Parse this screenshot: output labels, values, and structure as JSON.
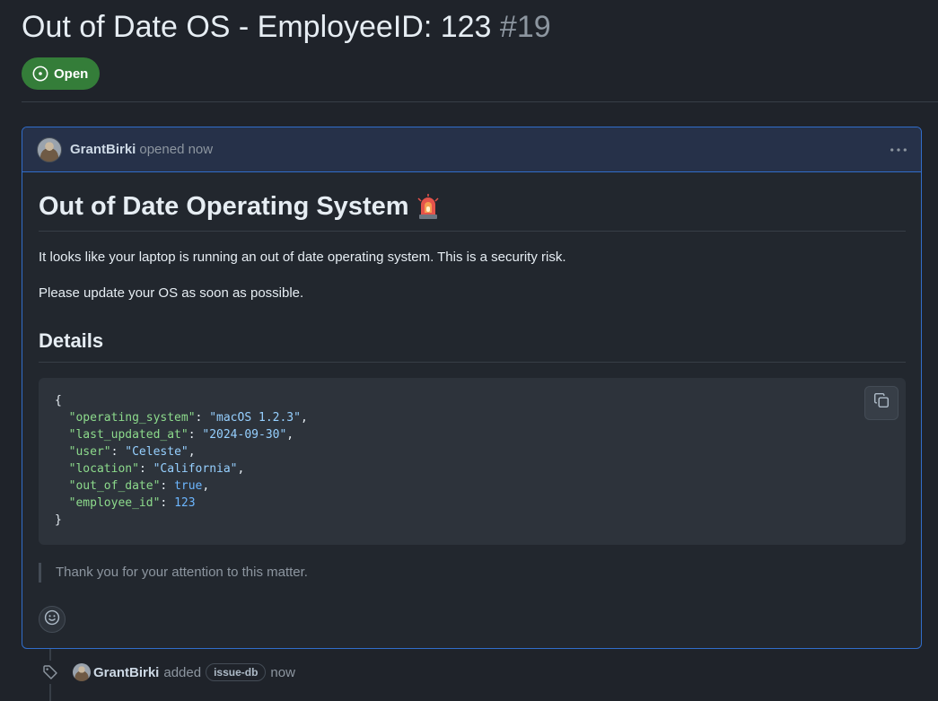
{
  "issue": {
    "title": "Out of Date OS - EmployeeID: 123",
    "number": "#19",
    "state": "Open",
    "state_color": "#347d39"
  },
  "comment": {
    "author": "GrantBirki",
    "opened_text": "opened now",
    "menu_icon": "kebab-horizontal-icon",
    "heading": "Out of Date Operating System",
    "heading_emoji": "rotating-light-icon",
    "paragraph1": "It looks like your laptop is running an out of date operating system. This is a security risk.",
    "paragraph2": "Please update your OS as soon as possible.",
    "details_heading": "Details",
    "code": {
      "open_brace": "{",
      "close_brace": "}",
      "entries": [
        {
          "key": "\"operating_system\"",
          "value": "\"macOS 1.2.3\"",
          "type": "str",
          "comma": ","
        },
        {
          "key": "\"last_updated_at\"",
          "value": "\"2024-09-30\"",
          "type": "str",
          "comma": ","
        },
        {
          "key": "\"user\"",
          "value": "\"Celeste\"",
          "type": "str",
          "comma": ","
        },
        {
          "key": "\"location\"",
          "value": "\"California\"",
          "type": "str",
          "comma": ","
        },
        {
          "key": "\"out_of_date\"",
          "value": "true",
          "type": "kw",
          "comma": ","
        },
        {
          "key": "\"employee_id\"",
          "value": "123",
          "type": "num",
          "comma": ""
        }
      ],
      "copy_icon": "copy-icon"
    },
    "blockquote": "Thank you for your attention to this matter.",
    "reaction_icon": "smiley-icon"
  },
  "timeline_event": {
    "icon": "tag-icon",
    "author": "GrantBirki",
    "action": "added",
    "label": "issue-db",
    "time": "now"
  },
  "colors": {
    "background": "#1f232a",
    "accent_border": "#316dca",
    "header_bg": "#263149"
  }
}
